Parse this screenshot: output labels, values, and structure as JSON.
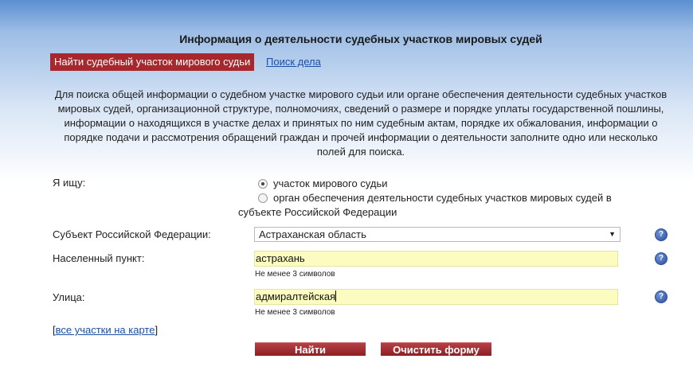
{
  "header": {
    "title": "Информация о деятельности судебных участков мировых судей"
  },
  "tabs": {
    "active": "Найти судебный участок мирового судьи",
    "link": "Поиск дела"
  },
  "intro": "Для поиска общей информации о судебном участке мирового судьи или органе обеспечения деятельности судебных участков мировых судей, организационной структуре, полномочиях, сведений о размере и порядке уплаты государственной пошлины, информации о находящихся в участке делах и принятых по ним судебным актам, порядке их обжалования, информации о порядке подачи и рассмотрения обращений граждан и прочей информации о деятельности заполните одно или несколько полей для поиска.",
  "form": {
    "search_for": {
      "label": "Я ищу:",
      "options": [
        {
          "label": "участок мирового судьи",
          "checked": true
        },
        {
          "label_line1": "орган обеспечения деятельности судебных участков мировых судей в",
          "label_line2": "субъекте Российской Федерации",
          "checked": false
        }
      ]
    },
    "subject": {
      "label": "Субъект Российской Федерации:",
      "value": "Астраханская область",
      "help_icon": "question-icon"
    },
    "locality": {
      "label": "Населенный пункт:",
      "value": "астрахань",
      "hint": "Не менее 3 символов",
      "help_icon": "question-icon"
    },
    "street": {
      "label": "Улица:",
      "value": "адмиралтейская",
      "hint": "Не менее 3 символов",
      "help_icon": "question-icon"
    },
    "map_link": "все участки на карте",
    "search_button": "Найти",
    "clear_button": "Очистить форму"
  },
  "colors": {
    "accent": "#a8272c",
    "link": "#1a4fa8",
    "input_bg": "#fcfcc0",
    "help_icon": "#2a4f9e"
  }
}
